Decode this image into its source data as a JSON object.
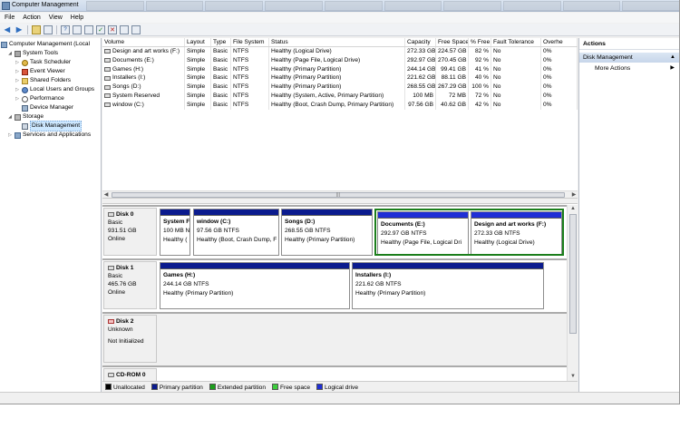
{
  "window": {
    "title": "Computer Management"
  },
  "menu": [
    "File",
    "Action",
    "View",
    "Help"
  ],
  "tree": {
    "root": "Computer Management (Local",
    "system_tools": "System Tools",
    "items": [
      "Task Scheduler",
      "Event Viewer",
      "Shared Folders",
      "Local Users and Groups",
      "Performance",
      "Device Manager"
    ],
    "storage": "Storage",
    "disk_management": "Disk Management",
    "services": "Services and Applications"
  },
  "volume_table": {
    "columns": [
      "Volume",
      "Layout",
      "Type",
      "File System",
      "Status",
      "Capacity",
      "Free Space",
      "% Free",
      "Fault Tolerance",
      "Overhe"
    ],
    "rows": [
      [
        "Design and art works (F:)",
        "Simple",
        "Basic",
        "NTFS",
        "Healthy (Logical Drive)",
        "272.33 GB",
        "224.57 GB",
        "82 %",
        "No",
        "0%"
      ],
      [
        "Documents (E:)",
        "Simple",
        "Basic",
        "NTFS",
        "Healthy (Page File, Logical Drive)",
        "292.97 GB",
        "270.45 GB",
        "92 %",
        "No",
        "0%"
      ],
      [
        "Games (H:)",
        "Simple",
        "Basic",
        "NTFS",
        "Healthy (Primary Partition)",
        "244.14 GB",
        "99.41 GB",
        "41 %",
        "No",
        "0%"
      ],
      [
        "Installers (I:)",
        "Simple",
        "Basic",
        "NTFS",
        "Healthy (Primary Partition)",
        "221.62 GB",
        "88.11 GB",
        "40 %",
        "No",
        "0%"
      ],
      [
        "Songs (D:)",
        "Simple",
        "Basic",
        "NTFS",
        "Healthy (Primary Partition)",
        "268.55 GB",
        "267.29 GB",
        "100 %",
        "No",
        "0%"
      ],
      [
        "System Reserved",
        "Simple",
        "Basic",
        "NTFS",
        "Healthy (System, Active, Primary Partition)",
        "100 MB",
        "72 MB",
        "72 %",
        "No",
        "0%"
      ],
      [
        "window (C:)",
        "Simple",
        "Basic",
        "NTFS",
        "Healthy (Boot, Crash Dump, Primary Partition)",
        "97.56 GB",
        "40.62 GB",
        "42 %",
        "No",
        "0%"
      ]
    ]
  },
  "disks": {
    "disk0": {
      "name": "Disk 0",
      "type": "Basic",
      "size": "931.51 GB",
      "status": "Online",
      "partitions": [
        {
          "name": "System F",
          "size": "100 MB N",
          "status": "Healthy (",
          "kind": "primary"
        },
        {
          "name": "window  (C:)",
          "size": "97.56 GB NTFS",
          "status": "Healthy (Boot, Crash Dump, F",
          "kind": "primary"
        },
        {
          "name": "Songs  (D:)",
          "size": "268.55 GB NTFS",
          "status": "Healthy (Primary Partition)",
          "kind": "primary"
        },
        {
          "name": "Documents  (E:)",
          "size": "292.97 GB NTFS",
          "status": "Healthy (Page File, Logical Dri",
          "kind": "logical"
        },
        {
          "name": "Design and art works  (F:)",
          "size": "272.33 GB NTFS",
          "status": "Healthy (Logical Drive)",
          "kind": "logical"
        }
      ]
    },
    "disk1": {
      "name": "Disk 1",
      "type": "Basic",
      "size": "465.76 GB",
      "status": "Online",
      "partitions": [
        {
          "name": "Games  (H:)",
          "size": "244.14 GB NTFS",
          "status": "Healthy (Primary Partition)",
          "kind": "primary"
        },
        {
          "name": "Installers  (I:)",
          "size": "221.62 GB NTFS",
          "status": "Healthy (Primary Partition)",
          "kind": "primary"
        }
      ]
    },
    "disk2": {
      "name": "Disk 2",
      "type": "Unknown",
      "status": "Not Initialized"
    },
    "cdrom0": {
      "name": "CD-ROM 0"
    }
  },
  "legend": [
    {
      "label": "Unallocated",
      "color": "#000000"
    },
    {
      "label": "Primary partition",
      "color": "#0b1b8e"
    },
    {
      "label": "Extended partition",
      "color": "#1b9e1b"
    },
    {
      "label": "Free space",
      "color": "#3ccc3c"
    },
    {
      "label": "Logical drive",
      "color": "#1f2fd6"
    }
  ],
  "actions": {
    "header": "Actions",
    "selected": "Disk Management",
    "more": "More Actions"
  }
}
